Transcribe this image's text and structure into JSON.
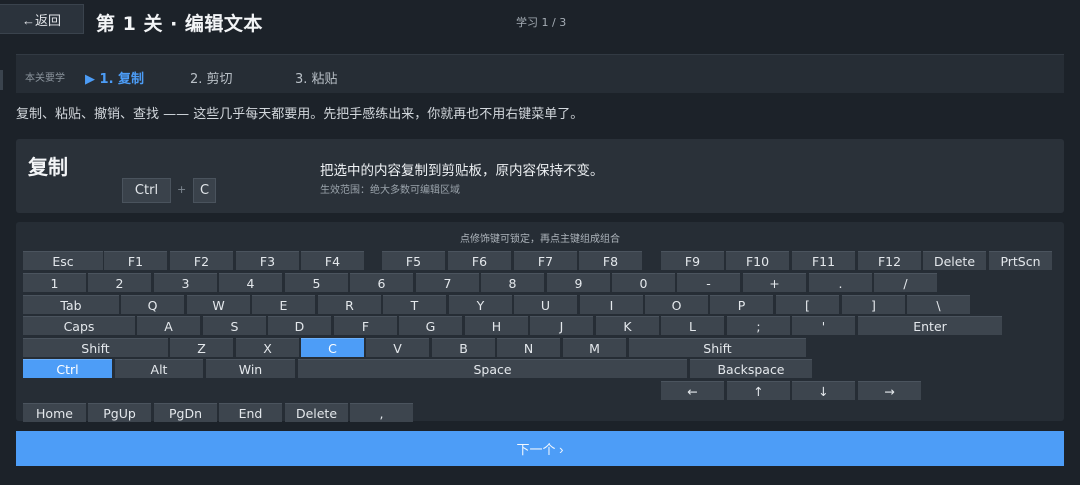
{
  "header": {
    "back_label": "←返回",
    "title": "第 1 关 · 编辑文本",
    "progress": "学习 1 / 3"
  },
  "lesson": {
    "label": "本关要学",
    "steps": [
      "▶ 1. 复制",
      "2. 剪切",
      "3. 粘贴"
    ],
    "active_step": 0,
    "description": "复制、粘贴、撤销、查找 —— 这些几乎每天都要用。先把手感练出来，你就再也不用右键菜单了。"
  },
  "shortcut_card": {
    "title": "复制",
    "keys": [
      "Ctrl",
      "C"
    ],
    "plus": "+",
    "description": "把选中的内容复制到剪贴板，原内容保持不变。",
    "scope": "生效范围：绝大多数可编辑区域"
  },
  "keyboard": {
    "hint": "点修饰键可锁定，再点主键组成组合",
    "highlighted_keys": [
      "C",
      "Ctrl"
    ],
    "rows": [
      [
        "Esc",
        "F1",
        "F2",
        "F3",
        "F4",
        "F5",
        "F6",
        "F7",
        "F8",
        "F9",
        "F10",
        "F11",
        "F12",
        "Delete",
        "PrtScn"
      ],
      [
        "1",
        "2",
        "3",
        "4",
        "5",
        "6",
        "7",
        "8",
        "9",
        "0",
        "-",
        "+",
        ".",
        "/"
      ],
      [
        "Tab",
        "Q",
        "W",
        "E",
        "R",
        "T",
        "Y",
        "U",
        "I",
        "O",
        "P",
        "[",
        "]",
        "\\"
      ],
      [
        "Caps",
        "A",
        "S",
        "D",
        "F",
        "G",
        "H",
        "J",
        "K",
        "L",
        ";",
        "'",
        "Enter"
      ],
      [
        "Shift",
        "Z",
        "X",
        "C",
        "V",
        "B",
        "N",
        "M",
        "Shift"
      ],
      [
        "Ctrl",
        "Alt",
        "Win",
        "Space",
        "Backspace"
      ],
      [
        "←",
        "↑",
        "↓",
        "→"
      ],
      [
        "Home",
        "PgUp",
        "PgDn",
        "End",
        "Delete",
        ","
      ]
    ]
  },
  "footer": {
    "next_label": "下一个 ›"
  },
  "colors": {
    "accent": "#4d9df7",
    "background": "#1c2229",
    "panel": "#262d35",
    "key": "#3d454e"
  }
}
